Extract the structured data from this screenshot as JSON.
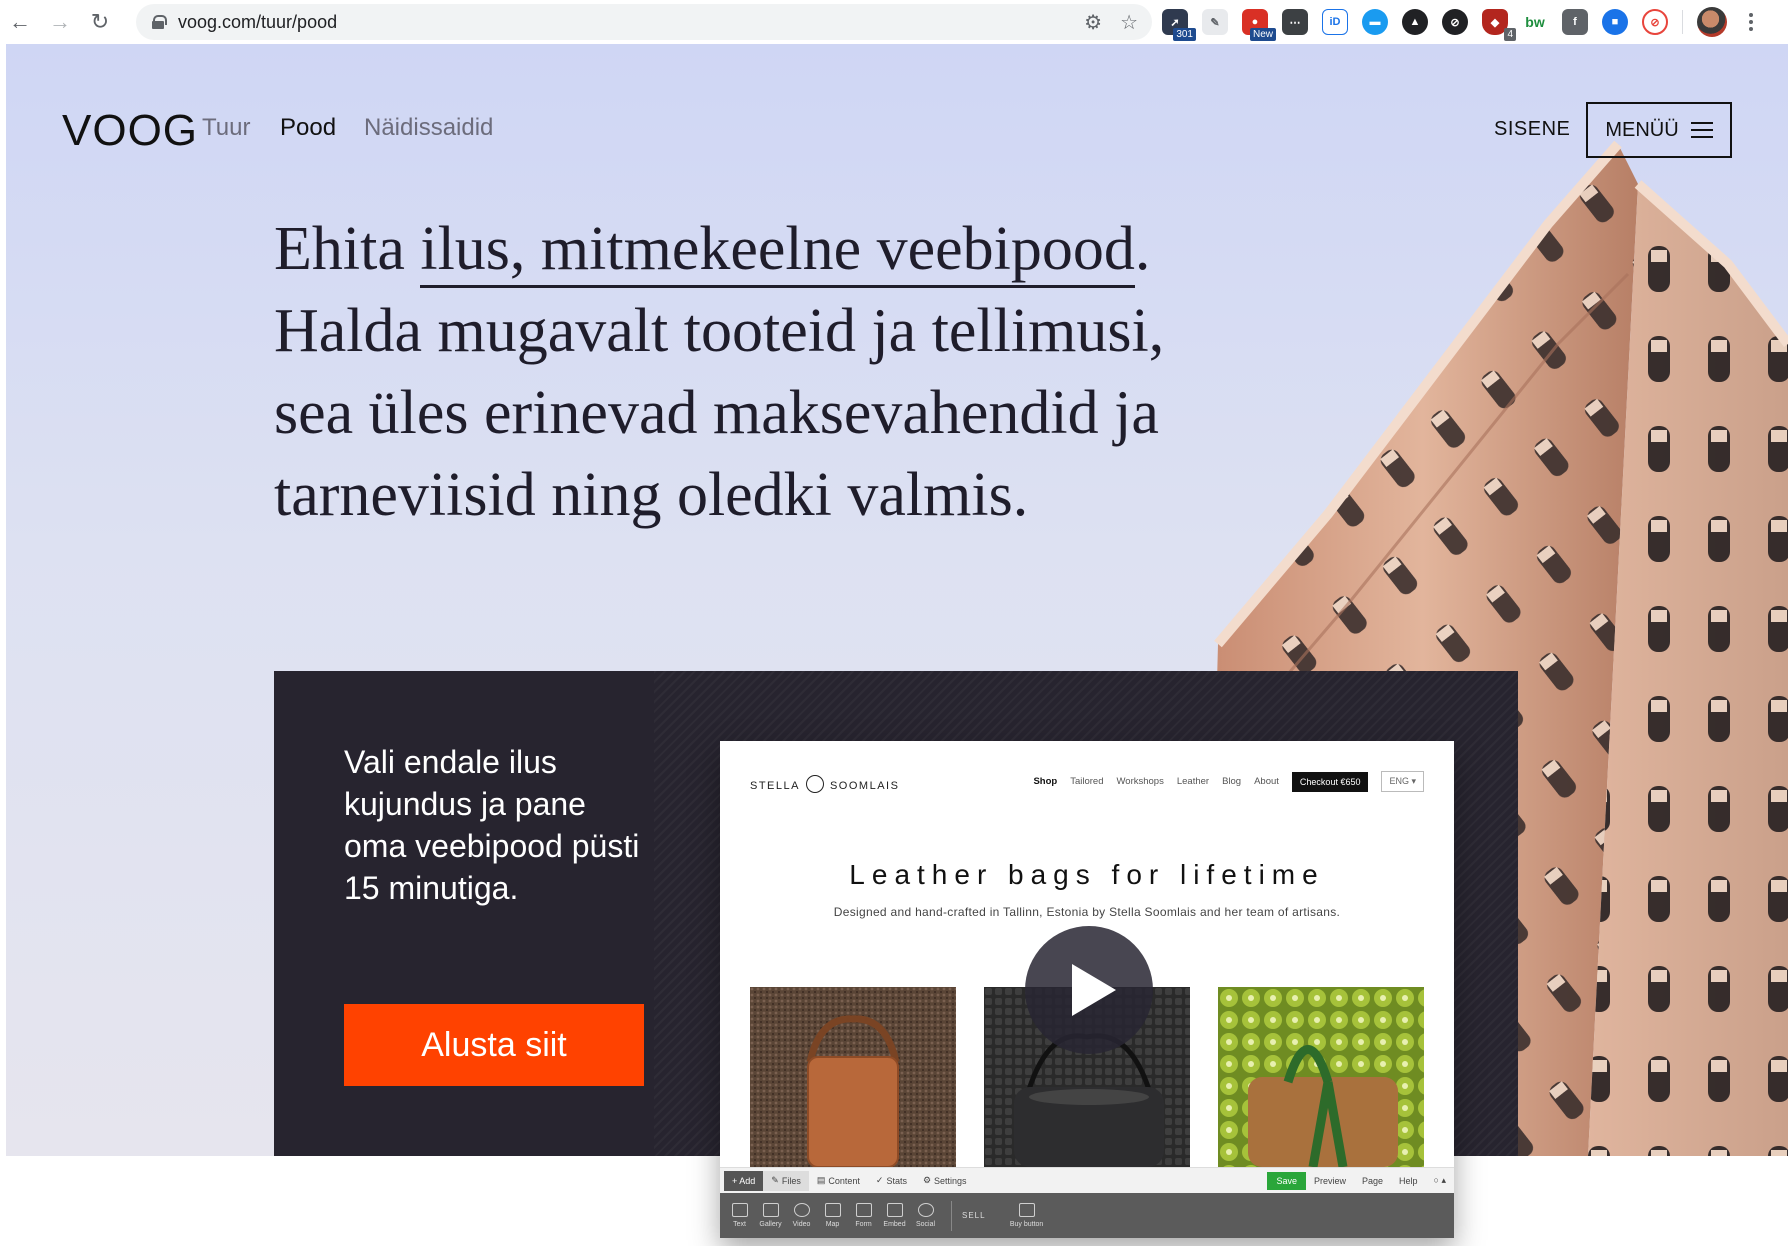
{
  "browser": {
    "url": "voog.com/tuur/pood",
    "extensions": [
      {
        "name": "redirect-path-icon",
        "badge": "301",
        "color": "#2f3a4f"
      },
      {
        "name": "screenshot-icon",
        "badge": "",
        "color": "#9aa0a6"
      },
      {
        "name": "colorzilla-icon",
        "badge": "New",
        "color": "#d93025"
      },
      {
        "name": "dots-ext-icon",
        "badge": "",
        "color": "#3c4043"
      },
      {
        "name": "id-ext-icon",
        "badge": "",
        "color": "#1a73e8"
      },
      {
        "name": "chat-ext-icon",
        "badge": "",
        "color": "#1a9bf0"
      },
      {
        "name": "fire-ext-icon",
        "badge": "",
        "color": "#202124"
      },
      {
        "name": "block-ext-icon",
        "badge": "",
        "color": "#202124"
      },
      {
        "name": "ublock-icon",
        "badge": "4",
        "color": "#b3261e"
      },
      {
        "name": "bw-ext-icon",
        "badge": "",
        "color": "#ffffff"
      },
      {
        "name": "facebook-ext-icon",
        "badge": "",
        "color": "#5f6368"
      },
      {
        "name": "video-ext-icon",
        "badge": "",
        "color": "#1a73e8"
      },
      {
        "name": "no-track-ext-icon",
        "badge": "",
        "color": "#e8453c"
      }
    ],
    "bw_label": "bw",
    "id_label": "iD"
  },
  "site": {
    "logo": "VOOG",
    "nav": [
      "Tuur",
      "Pood",
      "Näidissaidid"
    ],
    "login": "SISENE",
    "menu": "MENÜÜ"
  },
  "headline": {
    "pre": "Ehita ",
    "underlined": "ilus, mitmekeelne veebipood",
    "post": ".",
    "line2": "Halda mugavalt tooteid ja tellimusi,",
    "line3": "sea üles erinevad maksevahendid ja",
    "line4": "tarneviisid ning oledki valmis."
  },
  "promo": {
    "text": "Vali endale ilus kujundus ja pane oma veebipood püsti 15 minutiga.",
    "cta": "Alusta siit"
  },
  "preview": {
    "logo_left": "STELLA",
    "logo_right": "SOOMLAIS",
    "nav": [
      "Shop",
      "Tailored",
      "Workshops",
      "Leather",
      "Blog",
      "About"
    ],
    "checkout": "Checkout €650",
    "lang": "ENG ▾",
    "title": "Leather bags for lifetime",
    "subtitle": "Designed and hand-crafted in Tallinn, Estonia by Stella Soomlais and her team of artisans.",
    "toolbar": {
      "add": "+ Add",
      "files": "Files",
      "content": "Content",
      "stats": "Stats",
      "settings": "Settings",
      "save": "Save",
      "preview": "Preview",
      "page": "Page",
      "help": "Help"
    },
    "tools": [
      "Text",
      "Gallery",
      "Video",
      "Map",
      "Form",
      "Embed",
      "Social"
    ],
    "sell": "SELL",
    "buy_button": "Buy button"
  },
  "colors": {
    "accent": "#ff4200",
    "panel": "#27242f",
    "save_green": "#2aa63a"
  }
}
